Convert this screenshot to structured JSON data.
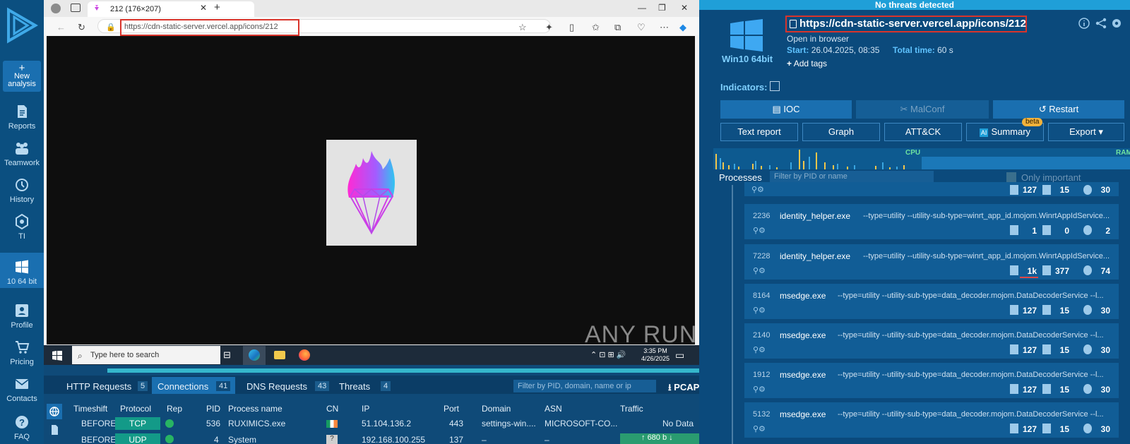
{
  "nav": {
    "new_analysis": "New analysis",
    "items": [
      {
        "label": "Reports"
      },
      {
        "label": "Teamwork"
      },
      {
        "label": "History"
      },
      {
        "label": "TI"
      },
      {
        "label": "10 64 bit"
      },
      {
        "label": "Profile"
      },
      {
        "label": "Pricing"
      },
      {
        "label": "Contacts"
      },
      {
        "label": "FAQ"
      }
    ]
  },
  "browser": {
    "tab_title": "212 (176×207)",
    "url": "https://cdn-static-server.vercel.app/icons/212",
    "watermark": "ANY RUN",
    "taskbar_search": "Type here to search",
    "clock_time": "3:35 PM",
    "clock_date": "4/26/2025"
  },
  "connections": {
    "tabs": [
      {
        "label": "HTTP Requests",
        "count": "5"
      },
      {
        "label": "Connections",
        "count": "41"
      },
      {
        "label": "DNS Requests",
        "count": "43"
      },
      {
        "label": "Threats",
        "count": "4"
      }
    ],
    "filter_placeholder": "Filter by PID, domain, name or ip",
    "pcap": "PCAP",
    "columns": [
      "Timeshift",
      "Protocol",
      "Rep",
      "PID",
      "Process name",
      "CN",
      "IP",
      "Port",
      "Domain",
      "ASN",
      "Traffic"
    ],
    "rows": [
      {
        "timeshift": "BEFORE",
        "protocol": "TCP",
        "pid": "536",
        "process": "RUXIMICS.exe",
        "ip": "51.104.136.2",
        "port": "443",
        "domain": "settings-win....",
        "asn": "MICROSOFT-CO...",
        "traffic": "No Data"
      },
      {
        "timeshift": "BEFORE",
        "protocol": "UDP",
        "pid": "4",
        "process": "System",
        "ip": "192.168.100.255",
        "port": "137",
        "domain": "–",
        "asn": "–",
        "traffic": "680 b"
      }
    ]
  },
  "right": {
    "status": "No threats detected",
    "os": "Win10 64bit",
    "url": "https://cdn-static-server.vercel.app/icons/212",
    "open_in_browser": "Open in browser",
    "start_label": "Start:",
    "start_value": "26.04.2025, 08:35",
    "total_label": "Total time:",
    "total_value": "60 s",
    "add_tags": "Add tags",
    "indicators": "Indicators:",
    "buttons": {
      "ioc": "IOC",
      "malconf": "MalConf",
      "restart": "Restart",
      "text_report": "Text report",
      "graph": "Graph",
      "attck": "ATT&CK",
      "summary": "Summary",
      "beta": "beta",
      "export": "Export",
      "ai": "AI"
    },
    "cpu": "CPU",
    "ram": "RAM",
    "processes_label": "Processes",
    "proc_filter": "Filter by PID or name",
    "only_important": "Only important",
    "top_stats": [
      "127",
      "15",
      "30"
    ],
    "processes": [
      {
        "pid": "2236",
        "name": "identity_helper.exe",
        "cmd": "--type=utility --utility-sub-type=winrt_app_id.mojom.WinrtAppIdService...",
        "stats": [
          "1",
          "0",
          "2"
        ]
      },
      {
        "pid": "7228",
        "name": "identity_helper.exe",
        "cmd": "--type=utility --utility-sub-type=winrt_app_id.mojom.WinrtAppIdService...",
        "stats": [
          "1k",
          "377",
          "74"
        ]
      },
      {
        "pid": "8164",
        "name": "msedge.exe",
        "cmd": "--type=utility --utility-sub-type=data_decoder.mojom.DataDecoderService --l...",
        "stats": [
          "127",
          "15",
          "30"
        ]
      },
      {
        "pid": "2140",
        "name": "msedge.exe",
        "cmd": "--type=utility --utility-sub-type=data_decoder.mojom.DataDecoderService --l...",
        "stats": [
          "127",
          "15",
          "30"
        ]
      },
      {
        "pid": "1912",
        "name": "msedge.exe",
        "cmd": "--type=utility --utility-sub-type=data_decoder.mojom.DataDecoderService --l...",
        "stats": [
          "127",
          "15",
          "30"
        ]
      },
      {
        "pid": "5132",
        "name": "msedge.exe",
        "cmd": "--type=utility --utility-sub-type=data_decoder.mojom.DataDecoderService --l...",
        "stats": [
          "127",
          "15",
          "30"
        ]
      }
    ]
  }
}
